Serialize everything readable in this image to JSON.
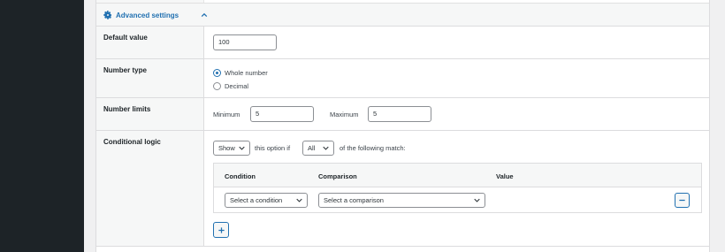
{
  "advanced": {
    "title": "Advanced settings"
  },
  "default_value": {
    "label": "Default value",
    "value": "100"
  },
  "number_type": {
    "label": "Number type",
    "options": [
      {
        "label": "Whole number",
        "checked": true
      },
      {
        "label": "Decimal",
        "checked": false
      }
    ]
  },
  "number_limits": {
    "label": "Number limits",
    "min_label": "Minimum",
    "min_value": "5",
    "max_label": "Maximum",
    "max_value": "5"
  },
  "conditional_logic": {
    "label": "Conditional logic",
    "action": "Show",
    "text_option_if": "this option if",
    "match": "All",
    "text_following": "of the following match:",
    "columns": {
      "condition": "Condition",
      "comparison": "Comparison",
      "value": "Value"
    },
    "condition_placeholder": "Select a condition",
    "comparison_placeholder": "Select a comparison"
  },
  "colors": {
    "accent": "#2271b1",
    "sidebar": "#1d2327",
    "label_bg": "#f6f7f7"
  }
}
